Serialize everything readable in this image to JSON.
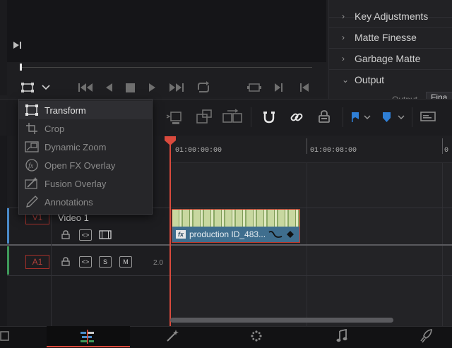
{
  "inspector": {
    "items": [
      {
        "label": "Key Adjustments",
        "chevron": "chevron-right"
      },
      {
        "label": "Matte Finesse",
        "chevron": "chevron-right"
      },
      {
        "label": "Garbage Matte",
        "chevron": "chevron-right"
      },
      {
        "label": "Output",
        "chevron": "chevron-down"
      }
    ],
    "output_sub_label": "Output",
    "output_value": "Fina"
  },
  "menu": {
    "items": [
      {
        "label": "Transform",
        "icon": "transform-icon",
        "active": true
      },
      {
        "label": "Crop",
        "icon": "crop-icon",
        "active": false
      },
      {
        "label": "Dynamic Zoom",
        "icon": "dynamic-zoom-icon",
        "active": false
      },
      {
        "label": "Open FX Overlay",
        "icon": "fx-icon",
        "active": false
      },
      {
        "label": "Fusion Overlay",
        "icon": "fusion-wand-icon",
        "active": false
      },
      {
        "label": "Annotations",
        "icon": "pen-icon",
        "active": false
      }
    ]
  },
  "timeline": {
    "timecodes": [
      "01:00:00:00",
      "01:00:08:00"
    ],
    "video_track": {
      "id": "V1",
      "name": "Video 1"
    },
    "audio_track": {
      "id": "A1",
      "level": "2.0",
      "solo_label": "S",
      "mute_label": "M"
    },
    "clip": {
      "fx_label": "fx",
      "name": "production ID_483..."
    }
  },
  "bottom_nav": {
    "pages": [
      "media",
      "edit",
      "fusion",
      "color",
      "fairlight",
      "deliver"
    ],
    "active": "edit"
  },
  "colors": {
    "accent_red": "#d94a3d",
    "flag_blue": "#2f7fd6",
    "clip_blue": "#3f6e8e"
  }
}
